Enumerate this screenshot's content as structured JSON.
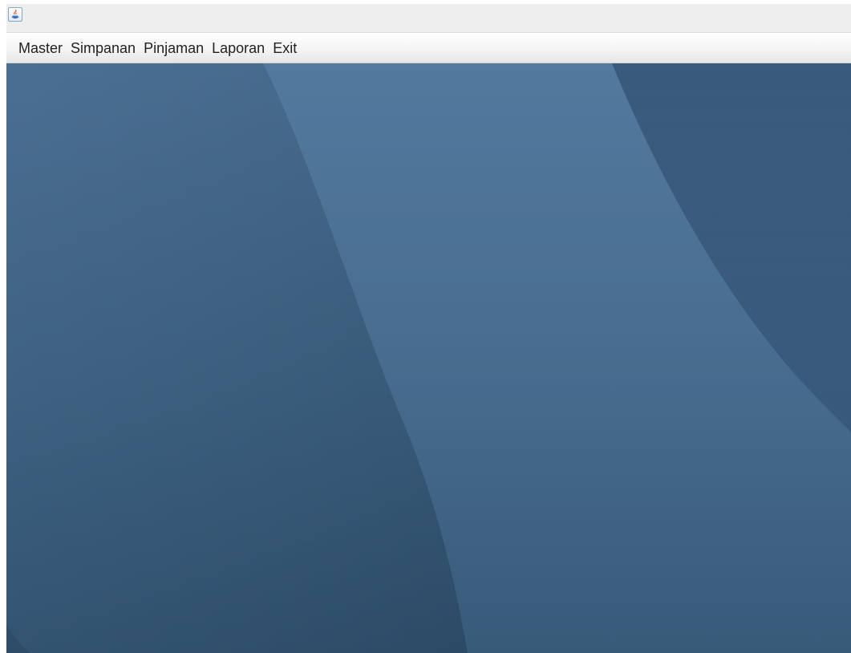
{
  "window": {
    "icon": "java-coffee-icon"
  },
  "menu": {
    "items": [
      {
        "label": "Master"
      },
      {
        "label": "Simpanan"
      },
      {
        "label": "Pinjaman"
      },
      {
        "label": "Laporan"
      },
      {
        "label": "Exit"
      }
    ]
  },
  "colors": {
    "desktop_light": "#4a6e91",
    "desktop_dark": "#2f4f6c",
    "menu_bar": "#f3f3f3",
    "title_bar": "#eeeeee"
  }
}
